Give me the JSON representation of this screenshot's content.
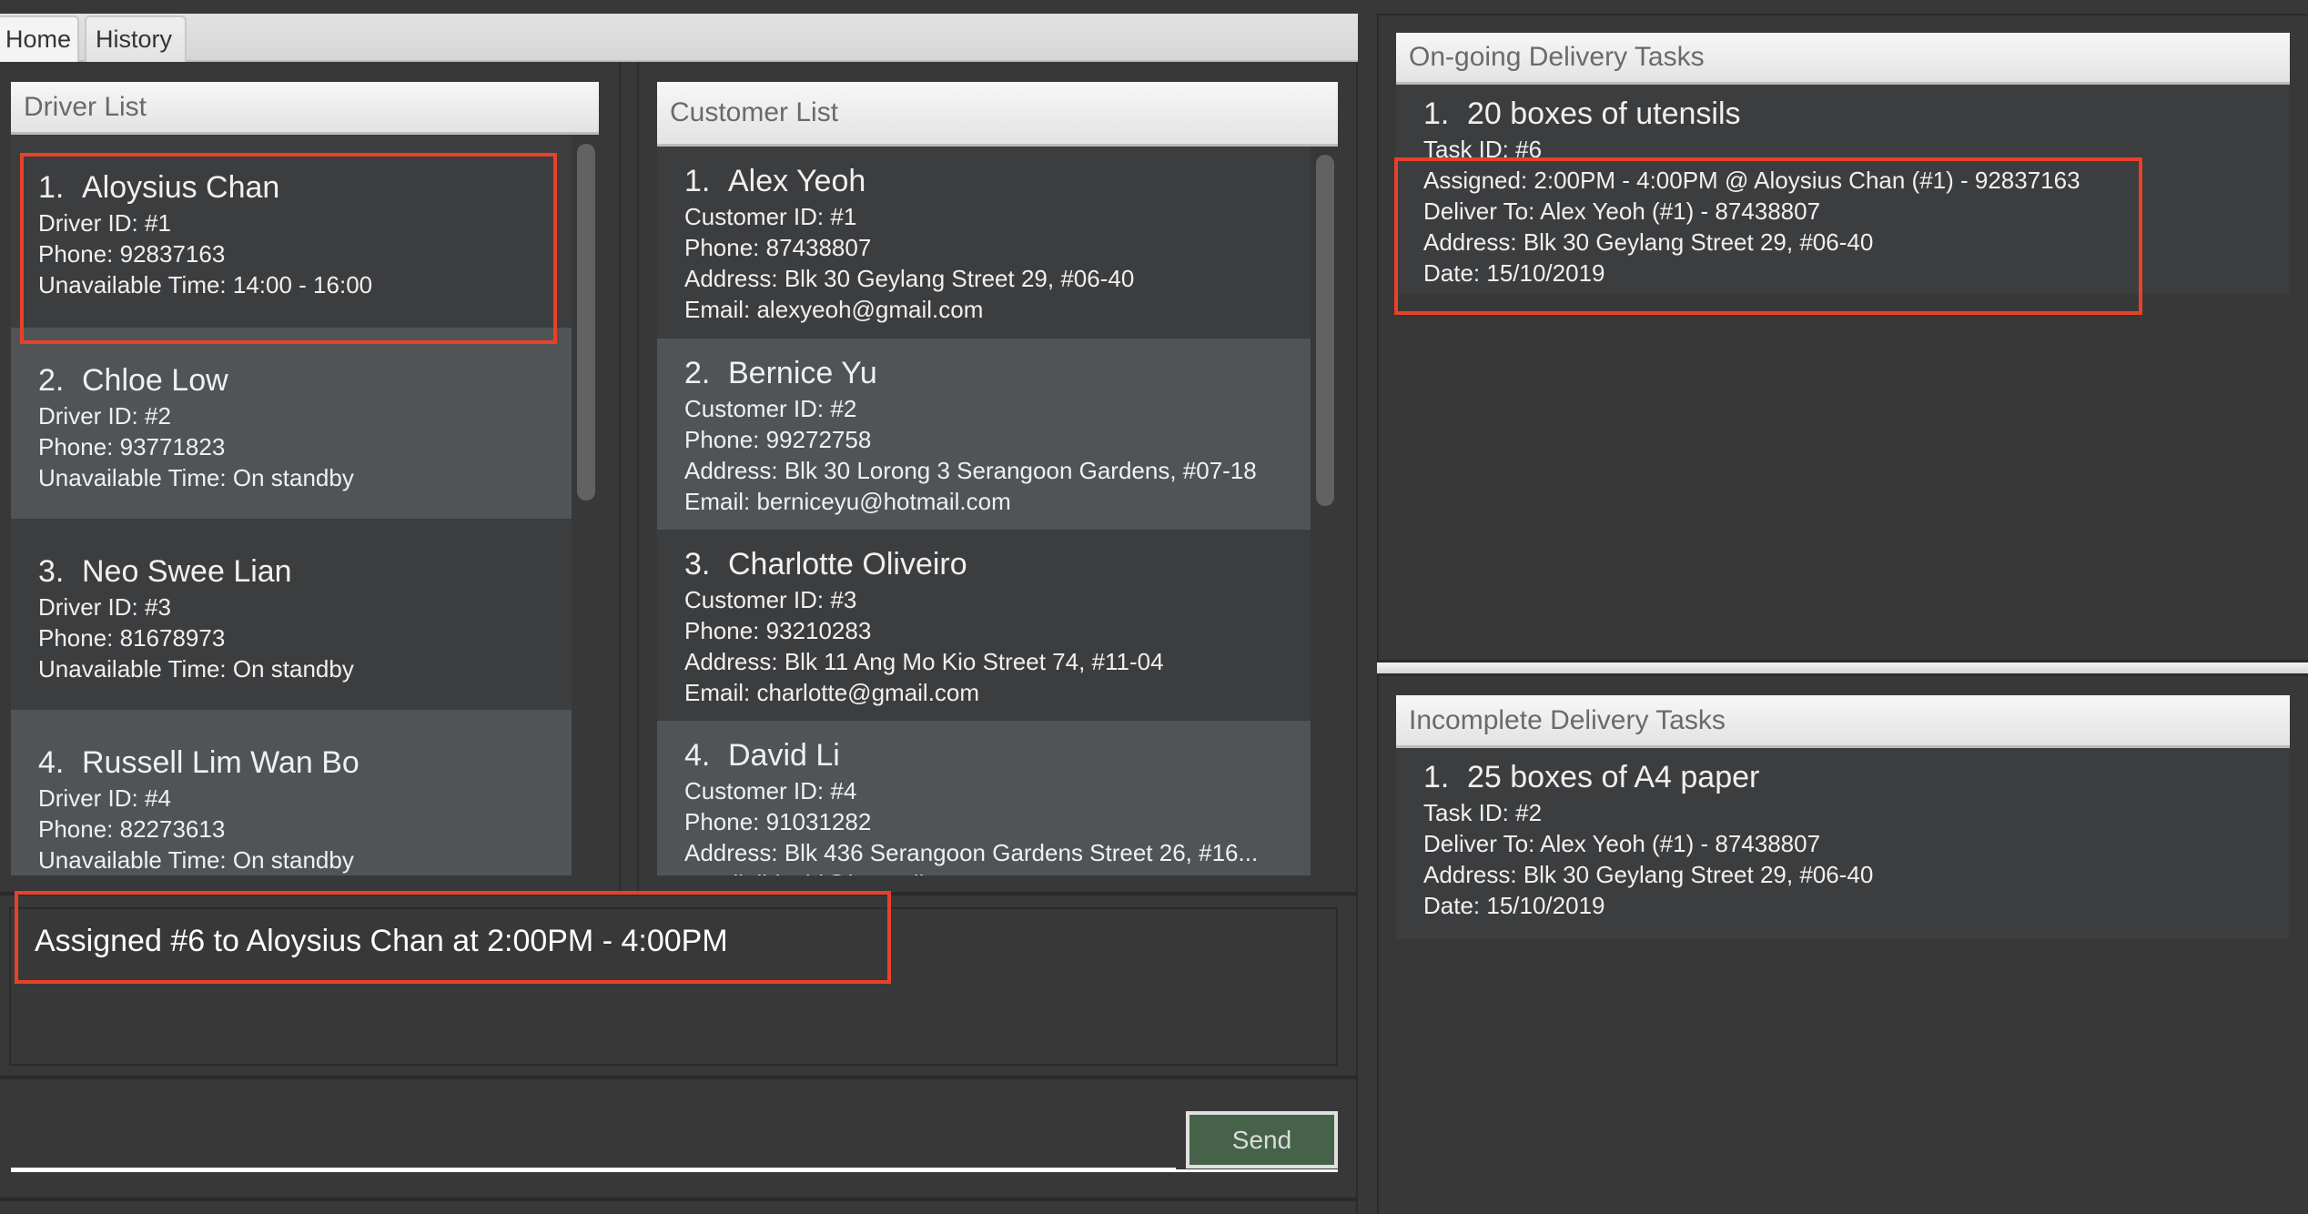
{
  "tabs": [
    {
      "label": "Home",
      "active": true
    },
    {
      "label": "History",
      "active": false
    }
  ],
  "driver_list": {
    "title": "Driver List",
    "items": [
      {
        "index": "1.",
        "name": "Aloysius Chan",
        "driver_id": "Driver ID: #1",
        "phone": "Phone: 92837163",
        "unavailable": "Unavailable Time: 14:00 - 16:00",
        "highlighted": true
      },
      {
        "index": "2.",
        "name": "Chloe Low",
        "driver_id": "Driver ID: #2",
        "phone": "Phone: 93771823",
        "unavailable": "Unavailable Time: On standby"
      },
      {
        "index": "3.",
        "name": "Neo Swee Lian",
        "driver_id": "Driver ID: #3",
        "phone": "Phone: 81678973",
        "unavailable": "Unavailable Time: On standby"
      },
      {
        "index": "4.",
        "name": "Russell Lim Wan Bo",
        "driver_id": "Driver ID: #4",
        "phone": "Phone: 82273613",
        "unavailable": "Unavailable Time: On standby"
      }
    ]
  },
  "customer_list": {
    "title": "Customer List",
    "items": [
      {
        "index": "1.",
        "name": "Alex Yeoh",
        "customer_id": "Customer ID: #1",
        "phone": "Phone: 87438807",
        "address": "Address: Blk 30 Geylang Street 29, #06-40",
        "email": "Email: alexyeoh@gmail.com"
      },
      {
        "index": "2.",
        "name": "Bernice Yu",
        "customer_id": "Customer ID: #2",
        "phone": "Phone: 99272758",
        "address": "Address: Blk 30 Lorong 3 Serangoon Gardens, #07-18",
        "email": "Email: berniceyu@hotmail.com"
      },
      {
        "index": "3.",
        "name": "Charlotte Oliveiro",
        "customer_id": "Customer ID: #3",
        "phone": "Phone: 93210283",
        "address": "Address: Blk 11 Ang Mo Kio Street 74, #11-04",
        "email": "Email: charlotte@gmail.com"
      },
      {
        "index": "4.",
        "name": "David Li",
        "customer_id": "Customer ID: #4",
        "phone": "Phone: 91031282",
        "address": "Address: Blk 436 Serangoon Gardens Street 26, #16...",
        "email": "Email: lidavid@hotmail.com"
      }
    ]
  },
  "result_display": {
    "text": "Assigned #6 to Aloysius Chan at 2:00PM - 4:00PM"
  },
  "command_box": {
    "value": "",
    "placeholder": "",
    "send_label": "Send"
  },
  "ongoing_tasks": {
    "title": "On-going Delivery Tasks",
    "items": [
      {
        "index": "1.",
        "description": "20 boxes of utensils",
        "task_id": "Task ID: #6",
        "assigned": "Assigned: 2:00PM - 4:00PM @ Aloysius Chan (#1) - 92837163",
        "deliver_to": "Deliver To: Alex Yeoh (#1) - 87438807",
        "address": "Address: Blk 30 Geylang Street 29, #06-40",
        "date": "Date: 15/10/2019"
      }
    ]
  },
  "incomplete_tasks": {
    "title": "Incomplete Delivery Tasks",
    "items": [
      {
        "index": "1.",
        "description": "25 boxes of A4 paper",
        "task_id": "Task ID: #2",
        "deliver_to": "Deliver To: Alex Yeoh (#1) - 87438807",
        "address": "Address: Blk 30 Geylang Street 29, #06-40",
        "date": "Date: 15/10/2019"
      }
    ]
  },
  "colors": {
    "background": "#383838",
    "row_dark": "#3c3d3f",
    "row_light": "#505457",
    "highlight": "#e8412a",
    "send_button": "#466349"
  }
}
